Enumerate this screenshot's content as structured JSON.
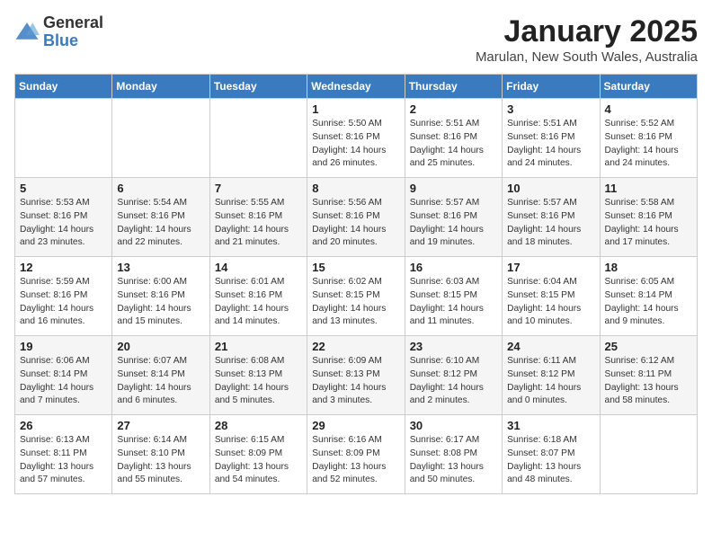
{
  "header": {
    "logo_general": "General",
    "logo_blue": "Blue",
    "month": "January 2025",
    "location": "Marulan, New South Wales, Australia"
  },
  "days_of_week": [
    "Sunday",
    "Monday",
    "Tuesday",
    "Wednesday",
    "Thursday",
    "Friday",
    "Saturday"
  ],
  "weeks": [
    [
      {
        "day": "",
        "data": ""
      },
      {
        "day": "",
        "data": ""
      },
      {
        "day": "",
        "data": ""
      },
      {
        "day": "1",
        "data": "Sunrise: 5:50 AM\nSunset: 8:16 PM\nDaylight: 14 hours\nand 26 minutes."
      },
      {
        "day": "2",
        "data": "Sunrise: 5:51 AM\nSunset: 8:16 PM\nDaylight: 14 hours\nand 25 minutes."
      },
      {
        "day": "3",
        "data": "Sunrise: 5:51 AM\nSunset: 8:16 PM\nDaylight: 14 hours\nand 24 minutes."
      },
      {
        "day": "4",
        "data": "Sunrise: 5:52 AM\nSunset: 8:16 PM\nDaylight: 14 hours\nand 24 minutes."
      }
    ],
    [
      {
        "day": "5",
        "data": "Sunrise: 5:53 AM\nSunset: 8:16 PM\nDaylight: 14 hours\nand 23 minutes."
      },
      {
        "day": "6",
        "data": "Sunrise: 5:54 AM\nSunset: 8:16 PM\nDaylight: 14 hours\nand 22 minutes."
      },
      {
        "day": "7",
        "data": "Sunrise: 5:55 AM\nSunset: 8:16 PM\nDaylight: 14 hours\nand 21 minutes."
      },
      {
        "day": "8",
        "data": "Sunrise: 5:56 AM\nSunset: 8:16 PM\nDaylight: 14 hours\nand 20 minutes."
      },
      {
        "day": "9",
        "data": "Sunrise: 5:57 AM\nSunset: 8:16 PM\nDaylight: 14 hours\nand 19 minutes."
      },
      {
        "day": "10",
        "data": "Sunrise: 5:57 AM\nSunset: 8:16 PM\nDaylight: 14 hours\nand 18 minutes."
      },
      {
        "day": "11",
        "data": "Sunrise: 5:58 AM\nSunset: 8:16 PM\nDaylight: 14 hours\nand 17 minutes."
      }
    ],
    [
      {
        "day": "12",
        "data": "Sunrise: 5:59 AM\nSunset: 8:16 PM\nDaylight: 14 hours\nand 16 minutes."
      },
      {
        "day": "13",
        "data": "Sunrise: 6:00 AM\nSunset: 8:16 PM\nDaylight: 14 hours\nand 15 minutes."
      },
      {
        "day": "14",
        "data": "Sunrise: 6:01 AM\nSunset: 8:16 PM\nDaylight: 14 hours\nand 14 minutes."
      },
      {
        "day": "15",
        "data": "Sunrise: 6:02 AM\nSunset: 8:15 PM\nDaylight: 14 hours\nand 13 minutes."
      },
      {
        "day": "16",
        "data": "Sunrise: 6:03 AM\nSunset: 8:15 PM\nDaylight: 14 hours\nand 11 minutes."
      },
      {
        "day": "17",
        "data": "Sunrise: 6:04 AM\nSunset: 8:15 PM\nDaylight: 14 hours\nand 10 minutes."
      },
      {
        "day": "18",
        "data": "Sunrise: 6:05 AM\nSunset: 8:14 PM\nDaylight: 14 hours\nand 9 minutes."
      }
    ],
    [
      {
        "day": "19",
        "data": "Sunrise: 6:06 AM\nSunset: 8:14 PM\nDaylight: 14 hours\nand 7 minutes."
      },
      {
        "day": "20",
        "data": "Sunrise: 6:07 AM\nSunset: 8:14 PM\nDaylight: 14 hours\nand 6 minutes."
      },
      {
        "day": "21",
        "data": "Sunrise: 6:08 AM\nSunset: 8:13 PM\nDaylight: 14 hours\nand 5 minutes."
      },
      {
        "day": "22",
        "data": "Sunrise: 6:09 AM\nSunset: 8:13 PM\nDaylight: 14 hours\nand 3 minutes."
      },
      {
        "day": "23",
        "data": "Sunrise: 6:10 AM\nSunset: 8:12 PM\nDaylight: 14 hours\nand 2 minutes."
      },
      {
        "day": "24",
        "data": "Sunrise: 6:11 AM\nSunset: 8:12 PM\nDaylight: 14 hours\nand 0 minutes."
      },
      {
        "day": "25",
        "data": "Sunrise: 6:12 AM\nSunset: 8:11 PM\nDaylight: 13 hours\nand 58 minutes."
      }
    ],
    [
      {
        "day": "26",
        "data": "Sunrise: 6:13 AM\nSunset: 8:11 PM\nDaylight: 13 hours\nand 57 minutes."
      },
      {
        "day": "27",
        "data": "Sunrise: 6:14 AM\nSunset: 8:10 PM\nDaylight: 13 hours\nand 55 minutes."
      },
      {
        "day": "28",
        "data": "Sunrise: 6:15 AM\nSunset: 8:09 PM\nDaylight: 13 hours\nand 54 minutes."
      },
      {
        "day": "29",
        "data": "Sunrise: 6:16 AM\nSunset: 8:09 PM\nDaylight: 13 hours\nand 52 minutes."
      },
      {
        "day": "30",
        "data": "Sunrise: 6:17 AM\nSunset: 8:08 PM\nDaylight: 13 hours\nand 50 minutes."
      },
      {
        "day": "31",
        "data": "Sunrise: 6:18 AM\nSunset: 8:07 PM\nDaylight: 13 hours\nand 48 minutes."
      },
      {
        "day": "",
        "data": ""
      }
    ]
  ]
}
